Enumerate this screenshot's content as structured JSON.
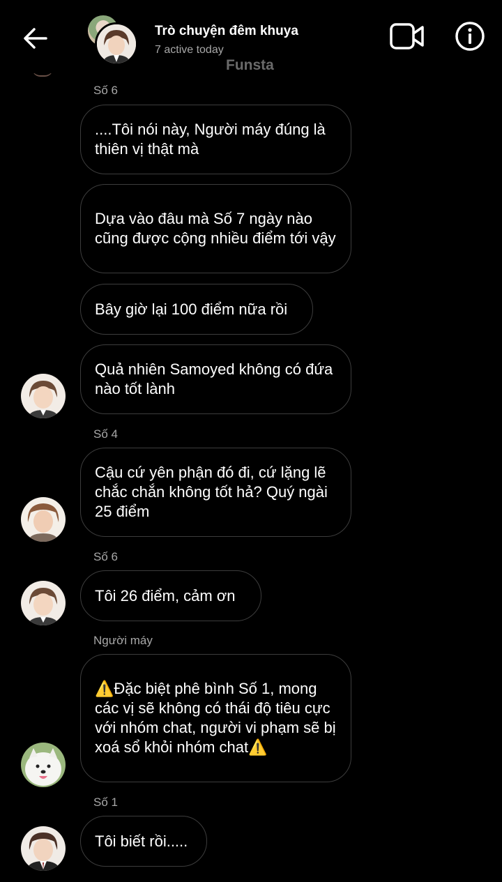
{
  "header": {
    "title": "Trò chuyện đêm khuya",
    "subtitle": "7 active today",
    "watermark": "Funsta",
    "icons": [
      "back-arrow-icon",
      "video-call-icon",
      "info-icon"
    ]
  },
  "messages": [
    {
      "sender": "Số 6",
      "text": "....Tôi nói này, Người máy đúng là thiên vị thật mà"
    },
    {
      "text": "Dựa vào đâu mà Số 7 ngày nào cũng được cộng nhiều điểm tới vậy"
    },
    {
      "text": "Bây giờ lại 100 điểm nữa rồi"
    },
    {
      "text": "Quả nhiên Samoyed không có đứa nào tốt lành"
    },
    {
      "sender": "Số 4",
      "text": "Cậu cứ yên phận đó đi, cứ lặng lẽ chắc chắn không tốt hả? Quý ngài 25 điểm"
    },
    {
      "sender": "Số 6",
      "text": "Tôi 26 điểm, cảm ơn"
    },
    {
      "sender": "Người máy",
      "text": "⚠️Đặc biệt phê bình Số 1, mong các vị sẽ không có thái độ tiêu cực với nhóm chat, người vi phạm sẽ bị xoá sổ khỏi nhóm chat⚠️"
    },
    {
      "sender": "Số 1",
      "text": "Tôi biết rồi....."
    }
  ],
  "colors": {
    "background": "#000000",
    "bubble_border": "#3d3d3d",
    "secondary_text": "#a8a8a8"
  }
}
